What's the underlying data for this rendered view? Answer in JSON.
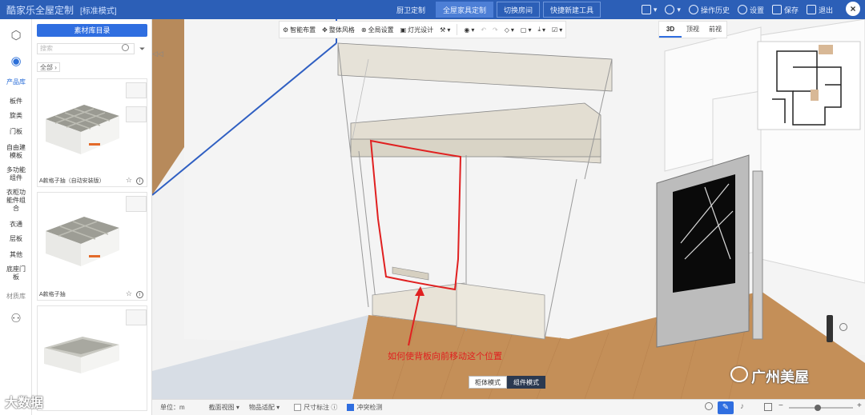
{
  "header": {
    "app_title": "酷家乐全屋定制",
    "mode": "[标准模式]",
    "tabs": [
      {
        "label": "厨卫定制",
        "active": false
      },
      {
        "label": "全屋家具定制",
        "active": true
      },
      {
        "label": "切换房间",
        "active": false
      },
      {
        "label": "快捷新建工具",
        "active": false
      }
    ],
    "right": [
      "操作历史",
      "设置",
      "保存",
      "退出"
    ]
  },
  "rail": {
    "product_lib": "产品库",
    "categories": [
      "板件",
      "旋类",
      "门板",
      "自由建模板",
      "多功能组件",
      "衣柜功能件组合",
      "衣通",
      "层板",
      "其他",
      "底座门板"
    ],
    "material_lib": "材质库"
  },
  "panel": {
    "catalog_button": "素材库目录",
    "search_placeholder": "搜索",
    "crumb": "全部",
    "products": [
      {
        "caption": "A款格子抽（自动安装版）"
      },
      {
        "caption": "A款格子抽"
      },
      {
        "caption": ""
      }
    ]
  },
  "toolbar": {
    "items": [
      "智能布置",
      "整体风格",
      "全局设置",
      "灯光设计"
    ],
    "view_tabs": [
      {
        "label": "3D",
        "active": true
      },
      {
        "label": "顶视",
        "active": false
      },
      {
        "label": "前视",
        "active": false
      }
    ]
  },
  "viewport": {
    "annotation": "如何使背板向前移动这个位置",
    "modes": [
      {
        "label": "柜体模式",
        "active": false
      },
      {
        "label": "组件模式",
        "active": true
      }
    ]
  },
  "status": {
    "unit": "单位：m",
    "items": [
      "截面视图",
      "物品适配"
    ],
    "dimension_label": "尺寸标注",
    "collision_label": "冲突检测",
    "zoom_level": 0.45
  },
  "watermarks": {
    "left": "大数据",
    "right": "广州美屋"
  },
  "colors": {
    "primary": "#2c5fb7",
    "accent": "#2f6ee0",
    "annotation": "#e02020"
  }
}
